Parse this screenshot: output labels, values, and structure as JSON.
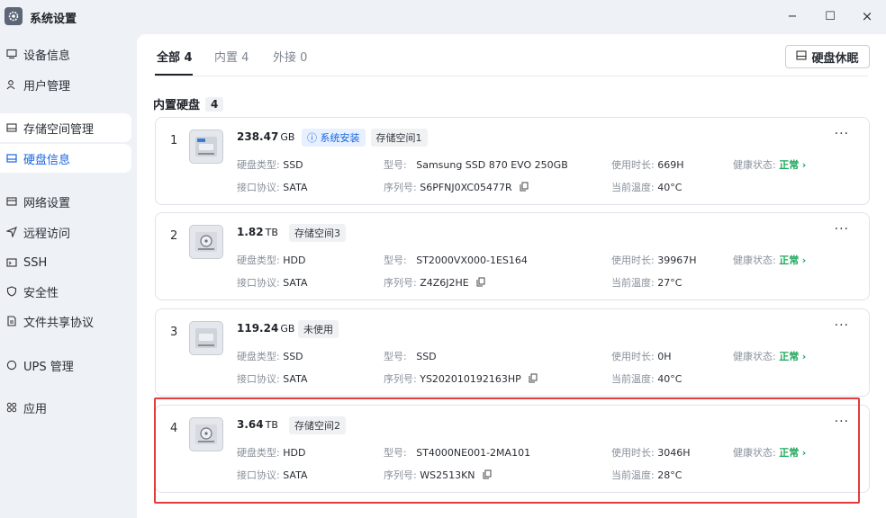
{
  "window": {
    "title": "系统设置",
    "minimize": "−",
    "maximize": "☐",
    "close": "×"
  },
  "sidebar": {
    "items": [
      {
        "label": "设备信息"
      },
      {
        "label": "用户管理"
      },
      {
        "label": "存储空间管理"
      },
      {
        "label": "硬盘信息"
      },
      {
        "label": "网络设置"
      },
      {
        "label": "远程访问"
      },
      {
        "label": "SSH"
      },
      {
        "label": "安全性"
      },
      {
        "label": "文件共享协议"
      },
      {
        "label": "UPS 管理"
      },
      {
        "label": "应用"
      }
    ]
  },
  "tabs": [
    {
      "label": "全部 4"
    },
    {
      "label": "内置 4"
    },
    {
      "label": "外接 0"
    }
  ],
  "sleep_button": "硬盘休眠",
  "section": {
    "title": "内置硬盘",
    "count": "4"
  },
  "field_labels": {
    "type": "硬盘类型:",
    "protocol": "接口协议:",
    "model": "型号:",
    "serial": "序列号:",
    "hours": "使用时长:",
    "temp": "当前温度:",
    "health": "健康状态:"
  },
  "more": "···",
  "disks": [
    {
      "index": "1",
      "size": "238.47",
      "unit": "GB",
      "tag_blue": "系统安装",
      "tag": "存储空间1",
      "type": "SSD",
      "protocol": "SATA",
      "model": "Samsung SSD 870 EVO 250GB",
      "serial": "S6PFNJ0XC05477R",
      "hours": "669H",
      "temp": "40°C",
      "health": "正常"
    },
    {
      "index": "2",
      "size": "1.82",
      "unit": "TB",
      "tag": "存储空间3",
      "type": "HDD",
      "protocol": "SATA",
      "model": "ST2000VX000-1ES164",
      "serial": "Z4Z6J2HE",
      "hours": "39967H",
      "temp": "27°C",
      "health": "正常"
    },
    {
      "index": "3",
      "size": "119.24",
      "unit": "GB",
      "tag": "未使用",
      "type": "SSD",
      "protocol": "SATA",
      "model": "SSD",
      "serial": "YS202010192163HP",
      "hours": "0H",
      "temp": "40°C",
      "health": "正常"
    },
    {
      "index": "4",
      "size": "3.64",
      "unit": "TB",
      "tag": "存储空间2",
      "type": "HDD",
      "protocol": "SATA",
      "model": "ST4000NE001-2MA101",
      "serial": "WS2513KN",
      "hours": "3046H",
      "temp": "28°C",
      "health": "正常"
    }
  ],
  "colors": {
    "accent": "#1a66e0",
    "ok": "#1ea85c",
    "highlight": "#e43c3c"
  }
}
